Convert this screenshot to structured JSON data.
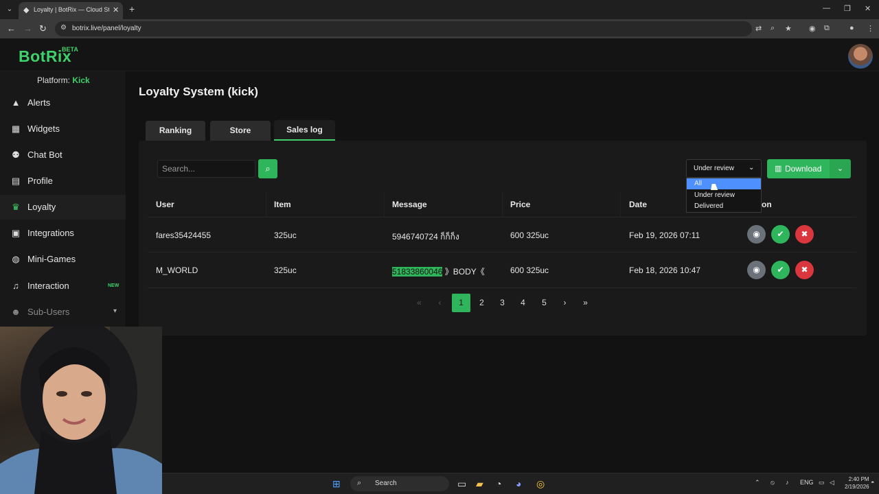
{
  "browser": {
    "tab_title": "Loyalty | BotRix — Cloud Strea",
    "url": "botrix.live/panel/loyalty"
  },
  "app": {
    "logo": "BotRix",
    "logo_badge": "BETA",
    "platform_label": "Platform:",
    "platform_value": "Kick"
  },
  "sidebar": {
    "items": [
      {
        "label": "Alerts",
        "icon": "warning-icon"
      },
      {
        "label": "Widgets",
        "icon": "grid-icon"
      },
      {
        "label": "Chat Bot",
        "icon": "robot-icon"
      },
      {
        "label": "Profile",
        "icon": "id-card-icon"
      },
      {
        "label": "Loyalty",
        "icon": "trophy-icon"
      },
      {
        "label": "Integrations",
        "icon": "integrations-icon"
      },
      {
        "label": "Mini-Games",
        "icon": "gamepad-icon"
      },
      {
        "label": "Interaction",
        "icon": "music-note-icon",
        "badge": "NEW"
      },
      {
        "label": "Sub-Users",
        "icon": "users-icon"
      }
    ]
  },
  "main": {
    "title": "Loyalty System (kick)",
    "tabs": [
      "Ranking",
      "Store",
      "Sales log"
    ],
    "search_placeholder": "Search...",
    "filter": {
      "selected": "Under review",
      "options": [
        "All",
        "Under review",
        "Delivered"
      ],
      "highlighted": "All"
    },
    "download_label": "Download",
    "table": {
      "headers": [
        "User",
        "Item",
        "Message",
        "Price",
        "Date",
        "on"
      ],
      "rows": [
        {
          "user": "fares35424455",
          "item": "325uc",
          "message_hl": "",
          "message": "5946740724 ก็ก็ก็ง",
          "price": "600 325uc",
          "date": "Feb 19, 2026 07:11"
        },
        {
          "user": "M_WORLD",
          "item": "325uc",
          "message_hl": "51833860046",
          "message": " 》BODY《",
          "price": "600 325uc",
          "date": "Feb 18, 2026 10:47"
        }
      ]
    },
    "pagination": {
      "pages": [
        "1",
        "2",
        "3",
        "4",
        "5"
      ],
      "current": "1"
    }
  },
  "taskbar": {
    "search_label": "Search",
    "lang": "ENG",
    "time": "2:40 PM",
    "date": "2/19/2026"
  }
}
